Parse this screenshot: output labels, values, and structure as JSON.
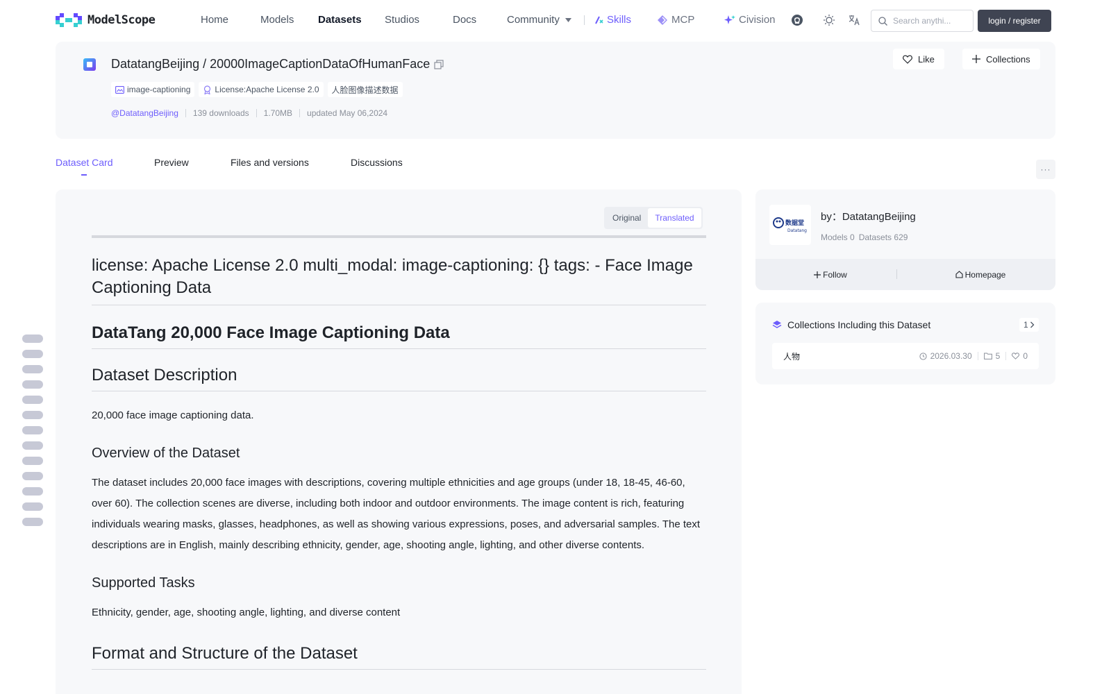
{
  "nav": {
    "logo_text": "ModelScope",
    "items": [
      "Home",
      "Models",
      "Datasets",
      "Studios",
      "Docs",
      "Community"
    ],
    "skills": "Skills",
    "mcp": "MCP",
    "civision": "Civision",
    "search_placeholder": "Search anythi...",
    "login": "login / register"
  },
  "dataset": {
    "title": "DatatangBeijing / 20000ImageCaptionDataOfHumanFace",
    "tags": [
      "image-captioning",
      "License:Apache License 2.0",
      "人脸图像描述数据"
    ],
    "author": "@DatatangBeijing",
    "downloads": "139 downloads",
    "size": "1.70MB",
    "updated": "updated May 06,2024",
    "like": "Like",
    "collections": "Collections"
  },
  "tabs": [
    "Dataset Card",
    "Preview",
    "Files and versions",
    "Discussions"
  ],
  "more": "···",
  "toggle": {
    "original": "Original",
    "translated": "Translated"
  },
  "content": {
    "front_matter": "license: Apache License 2.0 multi_modal: image-captioning: {} tags: - Face Image Captioning Data",
    "h1": "DataTang 20,000 Face Image Captioning Data",
    "desc_heading": "Dataset Description",
    "desc_text": "20,000 face image captioning data.",
    "overview_heading": "Overview of the Dataset",
    "overview_text": "The dataset includes 20,000 face images with descriptions, covering multiple ethnicities and age groups (under 18, 18-45, 46-60, over 60). The collection scenes are diverse, including both indoor and outdoor environments. The image content is rich, featuring individuals wearing masks, glasses, headphones, as well as showing various expressions, poses, and adversarial samples. The text descriptions are in English, mainly describing ethnicity, gender, age, shooting angle, lighting, and other diverse contents.",
    "tasks_heading": "Supported Tasks",
    "tasks_text": "Ethnicity, gender, age, shooting angle, lighting, and diverse content",
    "format_heading": "Format and Structure of the Dataset"
  },
  "author_card": {
    "name": "by：DatatangBeijing",
    "logo_text": "数据堂",
    "logo_sub": "Datatang",
    "models": "Models 0",
    "datasets": "Datasets 629",
    "follow": "Follow",
    "homepage": "Homepage"
  },
  "collections_card": {
    "title": "Collections Including this Dataset",
    "count": "1",
    "item_name": "人物",
    "item_date": "2026.03.30",
    "item_count": "5",
    "item_likes": "0"
  },
  "colors": {
    "accent": "#6d5dfc",
    "panel": "#f7f8fa",
    "dark_button": "#3f4452"
  }
}
